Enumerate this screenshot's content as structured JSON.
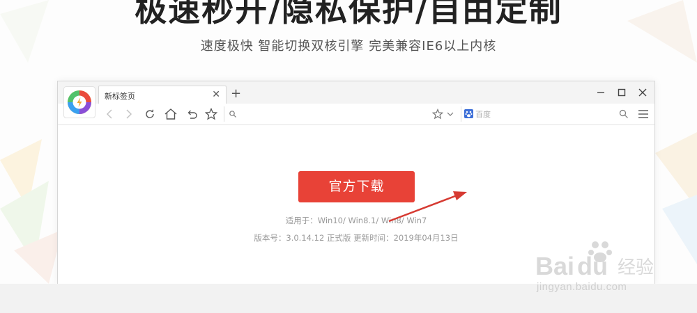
{
  "hero": {
    "title": "极速秒开/隐私保护/自由定制",
    "subtitle": "速度极快 智能切换双核引擎 完美兼容IE6以上内核"
  },
  "browser": {
    "tab_title": "新标签页",
    "search_placeholder": "百度",
    "window_controls": [
      "minimize-icon",
      "maximize-icon",
      "close-icon"
    ],
    "nav_icons": [
      "back-icon",
      "forward-icon",
      "refresh-icon",
      "home-icon",
      "undo-icon",
      "favorite-icon"
    ]
  },
  "page": {
    "download_button": "官方下载",
    "compat_text": "适用于：Win10/ Win8.1/ Win8/ Win7",
    "version_text": "版本号：3.0.14.12 正式版 更新时间：2019年04月13日"
  },
  "watermark": {
    "logo_text": "Baidu经验",
    "url": "jingyan.baidu.com"
  },
  "colors": {
    "accent": "#e84237",
    "annotation_arrow": "#d63a32"
  }
}
